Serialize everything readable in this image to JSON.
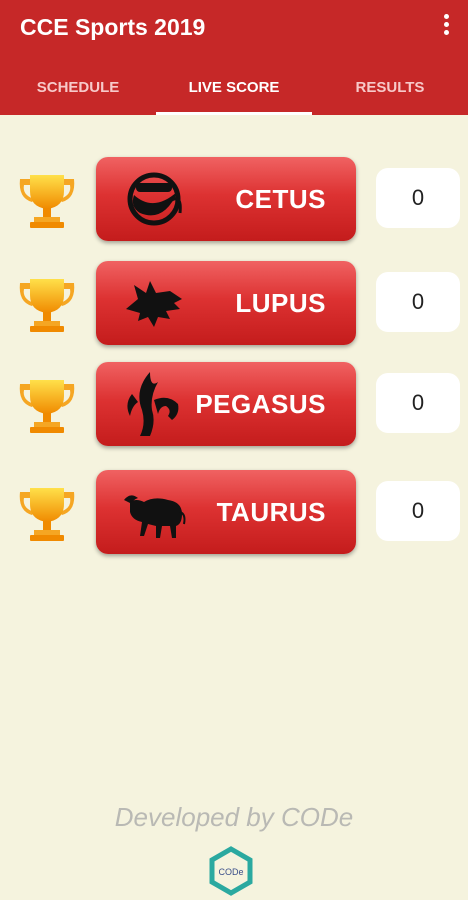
{
  "app": {
    "title": "CCE Sports 2019"
  },
  "tabs": [
    {
      "label": "SCHEDULE",
      "active": false
    },
    {
      "label": "LIVE SCORE",
      "active": true
    },
    {
      "label": "RESULTS",
      "active": false
    }
  ],
  "teams": [
    {
      "name": "CETUS",
      "score": "0",
      "logo": "cetus-emblem"
    },
    {
      "name": "LUPUS",
      "score": "0",
      "logo": "wolf-head"
    },
    {
      "name": "PEGASUS",
      "score": "0",
      "logo": "pegasus-emblem"
    },
    {
      "name": "TAURUS",
      "score": "0",
      "logo": "bull"
    }
  ],
  "footer": {
    "text": "Developed by CODe",
    "logo_text": "CODe"
  },
  "colors": {
    "appbar": "#c62828",
    "background": "#f5f3de",
    "trophy": "#f5a623"
  }
}
